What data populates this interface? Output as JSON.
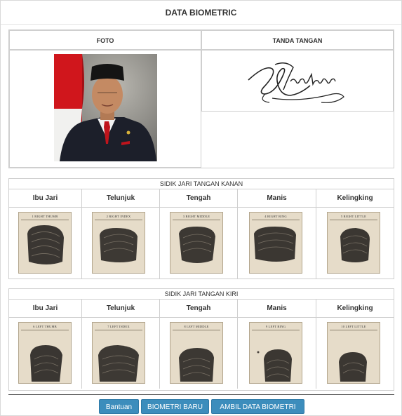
{
  "panel": {
    "title": "DATA BIOMETRIC"
  },
  "photo_signature": {
    "foto_header": "FOTO",
    "ttd_header": "TANDA TANGAN"
  },
  "right_hand": {
    "title": "SIDIK JARI TANGAN KANAN",
    "fingers": [
      {
        "header": "Ibu Jari",
        "card_label": "1   RIGHT THUMB"
      },
      {
        "header": "Telunjuk",
        "card_label": "2   RIGHT INDEX"
      },
      {
        "header": "Tengah",
        "card_label": "3   RIGHT MIDDLE"
      },
      {
        "header": "Manis",
        "card_label": "4   RIGHT RING"
      },
      {
        "header": "Kelingking",
        "card_label": "5   RIGHT LITTLE"
      }
    ]
  },
  "left_hand": {
    "title": "SIDIK JARI TANGAN KIRI",
    "fingers": [
      {
        "header": "Ibu Jari",
        "card_label": "6   LEFT THUMB"
      },
      {
        "header": "Telunjuk",
        "card_label": "7   LEFT INDEX"
      },
      {
        "header": "Tengah",
        "card_label": "8   LEFT MIDDLE"
      },
      {
        "header": "Manis",
        "card_label": "9   LEFT RING"
      },
      {
        "header": "Kelingking",
        "card_label": "10   LEFT LITTLE"
      }
    ]
  },
  "buttons": {
    "bantuan": "Bantuan",
    "biometri_baru": "BIOMETRI BARU",
    "ambil_data": "AMBIL DATA BIOMETRI"
  },
  "colors": {
    "button_bg": "#3c8dbc",
    "card_bg": "#e6dcc9",
    "ink": "#2b2b2b"
  }
}
